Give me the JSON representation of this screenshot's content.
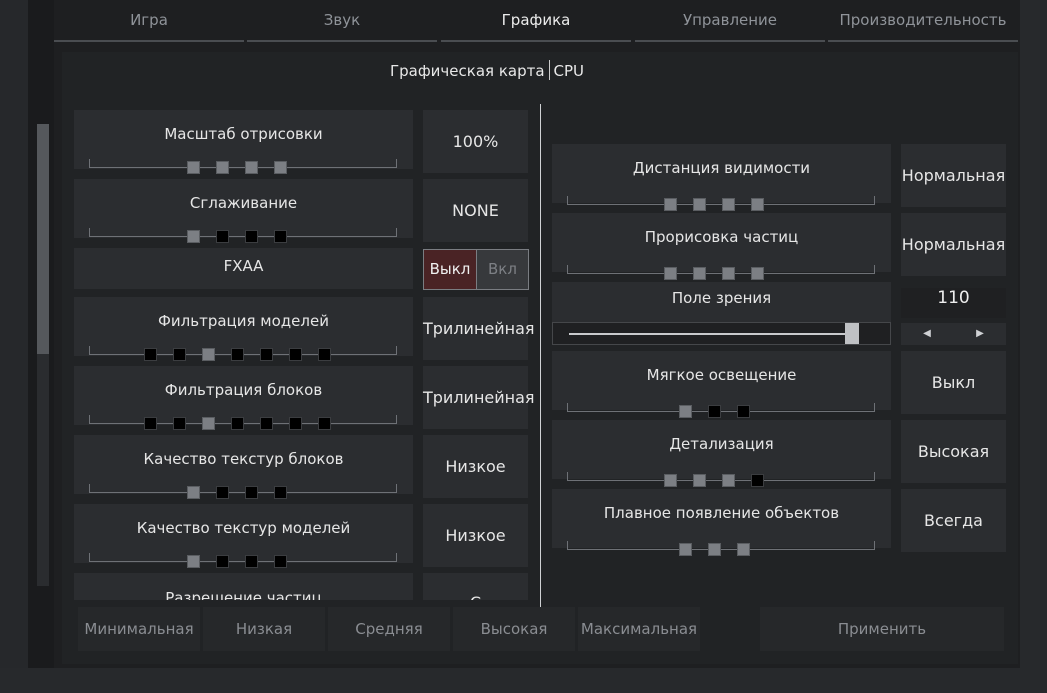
{
  "tabs": [
    "Игра",
    "Звук",
    "Графика",
    "Управление",
    "Производительность"
  ],
  "subheader": {
    "gpu": "Графическая карта",
    "cpu": "CPU"
  },
  "left": [
    {
      "label": "Масштаб отрисовки",
      "value": "100%",
      "dots": [
        1,
        1,
        1,
        1
      ]
    },
    {
      "label": "Сглаживание",
      "value": "NONE",
      "dots": [
        1,
        0,
        0,
        0
      ]
    },
    {
      "label": "FXAA",
      "toggle_off": "Выкл",
      "toggle_on": "Вкл"
    },
    {
      "label": "Фильтрация моделей",
      "value": "Трилинейная",
      "dots": [
        0,
        0,
        1,
        0,
        0,
        0,
        0
      ]
    },
    {
      "label": "Фильтрация блоков",
      "value": "Трилинейная",
      "dots": [
        0,
        0,
        1,
        0,
        0,
        0,
        0
      ]
    },
    {
      "label": "Качество текстур блоков",
      "value": "Низкое",
      "dots": [
        1,
        0,
        0,
        0
      ]
    },
    {
      "label": "Качество текстур моделей",
      "value": "Низкое",
      "dots": [
        1,
        0,
        0,
        0
      ]
    },
    {
      "label": "Разрешение частиц",
      "value": "С"
    }
  ],
  "right": [
    {
      "label": "Дистанция видимости",
      "value": "Нормальная",
      "dots": [
        1,
        1,
        1,
        1
      ]
    },
    {
      "label": "Прорисовка частиц",
      "value": "Нормальная",
      "dots": [
        1,
        1,
        1,
        1
      ]
    },
    {
      "label": "Поле зрения",
      "value": "110",
      "slider": 1.0
    },
    {
      "label": "Мягкое освещение",
      "value": "Выкл",
      "dots": [
        1,
        0,
        0
      ]
    },
    {
      "label": "Детализация",
      "value": "Высокая",
      "dots": [
        1,
        1,
        1,
        0
      ]
    },
    {
      "label": "Плавное появление объектов",
      "value": "Всегда",
      "dots": [
        1,
        1,
        1
      ]
    }
  ],
  "arrows": {
    "left": "◀",
    "right": "▶"
  },
  "presets": [
    "Минимальная",
    "Низкая",
    "Средняя",
    "Высокая",
    "Максимальная"
  ],
  "apply": "Применить"
}
